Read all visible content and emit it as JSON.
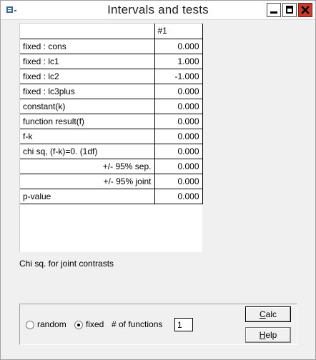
{
  "window": {
    "title": "Intervals and tests",
    "icon": "app-icon"
  },
  "table": {
    "columns": [
      "",
      "#1"
    ],
    "rows": [
      {
        "label": "fixed : cons",
        "value": "0.000",
        "align": "left"
      },
      {
        "label": "fixed : lc1",
        "value": "1.000",
        "align": "left"
      },
      {
        "label": "fixed : lc2",
        "value": "-1.000",
        "align": "left"
      },
      {
        "label": "fixed : lc3plus",
        "value": "0.000",
        "align": "left"
      },
      {
        "label": "constant(k)",
        "value": "0.000",
        "align": "left"
      },
      {
        "label": "function result(f)",
        "value": "0.000",
        "align": "left"
      },
      {
        "label": "f-k",
        "value": "0.000",
        "align": "left"
      },
      {
        "label": "chi sq, (f-k)=0. (1df)",
        "value": "0.000",
        "align": "left"
      },
      {
        "label": "+/- 95% sep.",
        "value": "0.000",
        "align": "right"
      },
      {
        "label": "+/- 95% joint",
        "value": "0.000",
        "align": "right"
      },
      {
        "label": "p-value",
        "value": "0.000",
        "align": "left"
      }
    ]
  },
  "note": "Chi sq. for joint contrasts",
  "controls": {
    "random_label": "random",
    "fixed_label": "fixed",
    "selected": "fixed",
    "num_functions_label": "# of functions",
    "num_functions_value": "1",
    "calc_prefix": "",
    "calc_accel": "C",
    "calc_rest": "alc",
    "help_prefix": "",
    "help_accel": "H",
    "help_rest": "elp"
  },
  "colors": {
    "close_button": "#c93b2c",
    "window_bg": "#f0f0f0"
  }
}
